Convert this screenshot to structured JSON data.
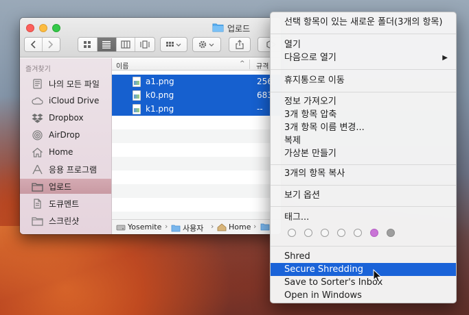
{
  "window": {
    "title": "업로드",
    "nav_back": "‹",
    "nav_forward": "›"
  },
  "sidebar": {
    "heading": "즐겨찾기",
    "items": [
      {
        "label": "나의 모든 파일",
        "icon": "all-files-icon"
      },
      {
        "label": "iCloud Drive",
        "icon": "cloud-icon"
      },
      {
        "label": "Dropbox",
        "icon": "dropbox-icon"
      },
      {
        "label": "AirDrop",
        "icon": "airdrop-icon"
      },
      {
        "label": "Home",
        "icon": "home-icon"
      },
      {
        "label": "응용 프로그램",
        "icon": "applications-icon"
      },
      {
        "label": "업로드",
        "icon": "folder-icon",
        "selected": true
      },
      {
        "label": "도큐멘트",
        "icon": "documents-icon"
      },
      {
        "label": "스크린샷",
        "icon": "folder-icon"
      }
    ]
  },
  "list": {
    "col_name": "이름",
    "col_size": "규격",
    "rows": [
      {
        "name": "a1.png",
        "size": "256",
        "selected": true
      },
      {
        "name": "k0.png",
        "size": "683",
        "selected": true
      },
      {
        "name": "k1.png",
        "size": "--",
        "selected": true
      }
    ]
  },
  "pathbar": {
    "crumbs": [
      "Yosemite",
      "사용자",
      "Home"
    ]
  },
  "context_menu": {
    "items": [
      {
        "label": "선택 항목이 있는 새로운 폴더(3개의 항목)"
      },
      {
        "label": "열기"
      },
      {
        "label": "다음으로 열기",
        "submenu_arrow": "▶"
      },
      {
        "label": "휴지통으로 이동"
      },
      {
        "label": "정보 가져오기"
      },
      {
        "label": "3개 항목 압축"
      },
      {
        "label": "3개 항목 이름 변경..."
      },
      {
        "label": "복제"
      },
      {
        "label": "가상본 만들기"
      },
      {
        "label": "3개의 항목 복사"
      },
      {
        "label": "보기 옵션"
      },
      {
        "label": "태그..."
      },
      {
        "label": "Shred"
      },
      {
        "label": "Secure Shredding",
        "highlighted": true
      },
      {
        "label": "Save to Sorter's Inbox"
      },
      {
        "label": "Open in Windows"
      }
    ],
    "tag_colors": [
      "none",
      "none",
      "none",
      "none",
      "none",
      "#c974d6",
      "#9e9e9e"
    ]
  },
  "colors": {
    "selection_blue": "#1660cf",
    "menu_highlight": "#1a63d8",
    "sidebar_selected": "#c99aa3"
  }
}
